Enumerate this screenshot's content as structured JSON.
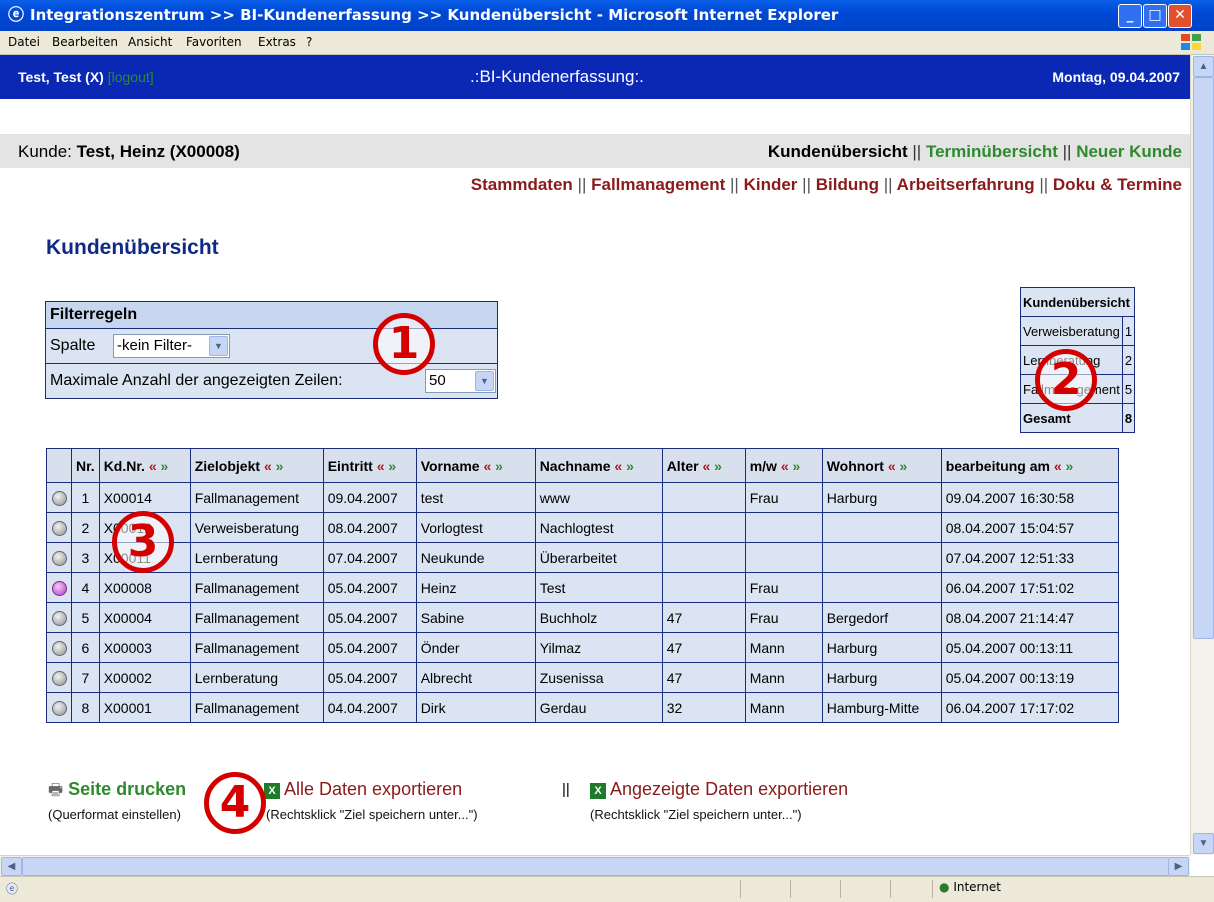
{
  "window": {
    "title": "Integrationszentrum >> BI-Kundenerfassung >> Kundenübersicht - Microsoft Internet Explorer",
    "min_label": "_",
    "max_label": "□",
    "close_label": "✕"
  },
  "menu": [
    "Datei",
    "Bearbeiten",
    "Ansicht",
    "Favoriten",
    "Extras",
    "?"
  ],
  "header": {
    "user": "Test, Test (X)",
    "logout": "[logout]",
    "app_title": ".:BI-Kundenerfassung:.",
    "date": "Montag, 09.04.2007"
  },
  "kunde": {
    "label": "Kunde: ",
    "name": "Test, Heinz (X00008)"
  },
  "nav": {
    "active": "Kundenübersicht",
    "termine": "Terminübersicht",
    "neu": "Neuer Kunde",
    "sep": "||"
  },
  "subnav": [
    "Stammdaten",
    "Fallmanagement",
    "Kinder",
    "Bildung",
    "Arbeitserfahrung",
    "Doku & Termine"
  ],
  "page_title": "Kundenübersicht",
  "filter": {
    "heading": "Filterregeln",
    "spalte_label": "Spalte",
    "spalte_value": "-kein Filter-",
    "rows_label": "Maximale Anzahl der angezeigten Zeilen:",
    "rows_value": "50"
  },
  "summary": {
    "heading": "Kundenübersicht",
    "rows": [
      {
        "label": "Verweisberatung",
        "value": "1"
      },
      {
        "label": "Lernberatung",
        "value": "2"
      },
      {
        "label": "Fallmanagement",
        "value": "5"
      }
    ],
    "total_label": "Gesamt",
    "total_value": "8"
  },
  "table": {
    "headers": [
      "Nr.",
      "Kd.Nr.",
      "Zielobjekt",
      "Eintritt",
      "Vorname",
      "Nachname",
      "Alter",
      "m/w",
      "Wohnort",
      "bearbeitung am"
    ],
    "sort_left": "«",
    "sort_right": "»",
    "rows": [
      {
        "nr": "1",
        "kdnr": "X00014",
        "ziel": "Fallmanagement",
        "eintritt": "09.04.2007",
        "vorname": "test",
        "nachname": "www",
        "alter": "",
        "mw": "Frau",
        "wohnort": "Harburg",
        "bearb": "09.04.2007 16:30:58"
      },
      {
        "nr": "2",
        "kdnr": "X00012",
        "ziel": "Verweisberatung",
        "eintritt": "08.04.2007",
        "vorname": "Vorlogtest",
        "nachname": "Nachlogtest",
        "alter": "",
        "mw": "",
        "wohnort": "",
        "bearb": "08.04.2007 15:04:57"
      },
      {
        "nr": "3",
        "kdnr": "X00011",
        "ziel": "Lernberatung",
        "eintritt": "07.04.2007",
        "vorname": "Neukunde",
        "nachname": "Überarbeitet",
        "alter": "",
        "mw": "",
        "wohnort": "",
        "bearb": "07.04.2007 12:51:33"
      },
      {
        "nr": "4",
        "kdnr": "X00008",
        "ziel": "Fallmanagement",
        "eintritt": "05.04.2007",
        "vorname": "Heinz",
        "nachname": "Test",
        "alter": "",
        "mw": "Frau",
        "wohnort": "",
        "bearb": "06.04.2007 17:51:02"
      },
      {
        "nr": "5",
        "kdnr": "X00004",
        "ziel": "Fallmanagement",
        "eintritt": "05.04.2007",
        "vorname": "Sabine",
        "nachname": "Buchholz",
        "alter": "47",
        "mw": "Frau",
        "wohnort": "Bergedorf",
        "bearb": "08.04.2007 21:14:47"
      },
      {
        "nr": "6",
        "kdnr": "X00003",
        "ziel": "Fallmanagement",
        "eintritt": "05.04.2007",
        "vorname": "Önder",
        "nachname": "Yilmaz",
        "alter": "47",
        "mw": "Mann",
        "wohnort": "Harburg",
        "bearb": "05.04.2007 00:13:11"
      },
      {
        "nr": "7",
        "kdnr": "X00002",
        "ziel": "Lernberatung",
        "eintritt": "05.04.2007",
        "vorname": "Albrecht",
        "nachname": "Zusenissa",
        "alter": "47",
        "mw": "Mann",
        "wohnort": "Harburg",
        "bearb": "05.04.2007 00:13:19"
      },
      {
        "nr": "8",
        "kdnr": "X00001",
        "ziel": "Fallmanagement",
        "eintritt": "04.04.2007",
        "vorname": "Dirk",
        "nachname": "Gerdau",
        "alter": "32",
        "mw": "Mann",
        "wohnort": "Hamburg-Mitte",
        "bearb": "06.04.2007 17:17:02"
      }
    ],
    "active_row": "4"
  },
  "footer": {
    "print": "Seite drucken",
    "print_hint": "(Querformat einstellen)",
    "export_all": "Alle Daten exportieren",
    "export_all_hint": "(Rechtsklick \"Ziel speichern unter...\")",
    "sep": "||",
    "export_shown": "Angezeigte Daten exportieren",
    "export_shown_hint": "(Rechtsklick \"Ziel speichern unter...\")"
  },
  "badges": [
    "1",
    "2",
    "3",
    "4"
  ],
  "status": {
    "zone": "Internet"
  },
  "colors": {
    "header_blue": "#0a28b4",
    "nav_green": "#2d8a2d",
    "subnav_red": "#8b1a1a",
    "badge_red": "#d40000",
    "table_bg": "#dbe4f2"
  }
}
